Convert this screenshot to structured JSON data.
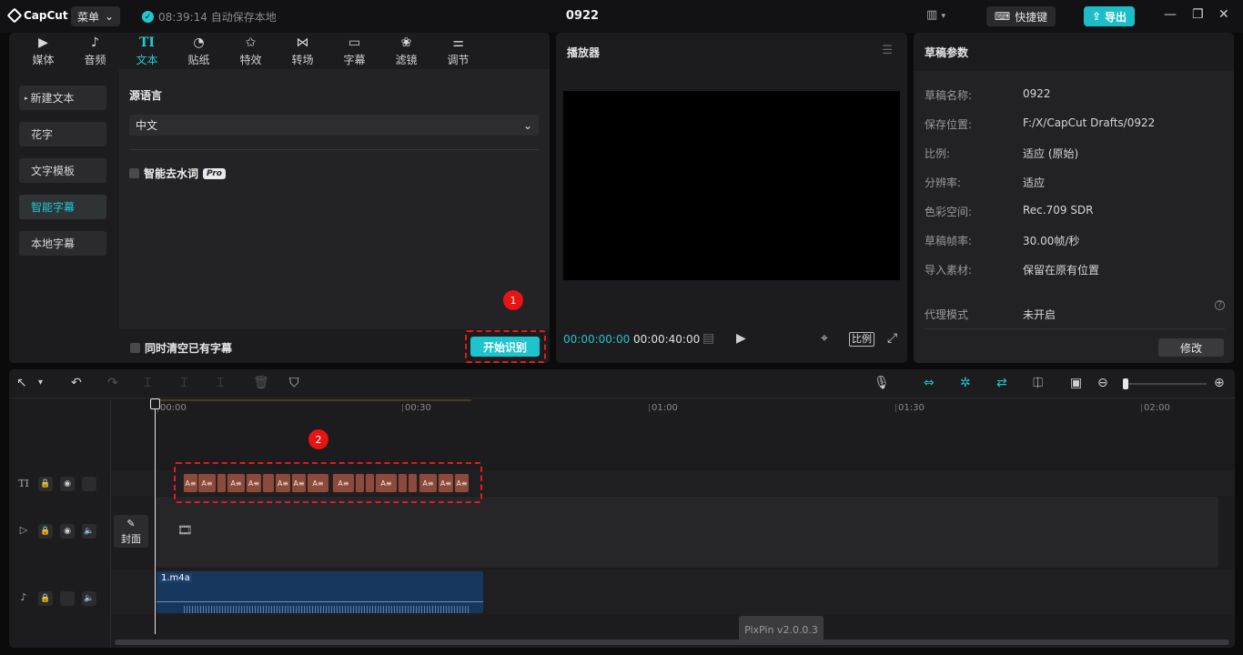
{
  "app": {
    "logo_text": "CapCut",
    "menu_label": "菜单",
    "autosave_text": "08:39:14 自动保存本地",
    "project_title": "0922",
    "shortcut_label": "快捷键",
    "export_label": "导出"
  },
  "tabs": [
    {
      "label": "媒体",
      "icon": "media-icon"
    },
    {
      "label": "音频",
      "icon": "audio-icon"
    },
    {
      "label": "文本",
      "icon": "text-icon",
      "glyph": "TI"
    },
    {
      "label": "贴纸",
      "icon": "sticker-icon"
    },
    {
      "label": "特效",
      "icon": "effects-icon"
    },
    {
      "label": "转场",
      "icon": "transition-icon"
    },
    {
      "label": "字幕",
      "icon": "captions-icon"
    },
    {
      "label": "滤镜",
      "icon": "filter-icon"
    },
    {
      "label": "调节",
      "icon": "adjust-icon"
    }
  ],
  "sidebar": {
    "items": [
      "新建文本",
      "花字",
      "文字模板",
      "智能字幕",
      "本地字幕"
    ],
    "active": "智能字幕"
  },
  "caption": {
    "source_lang_label": "源语言",
    "source_lang_value": "中文",
    "filler_label": "智能去水词",
    "pro_badge": "Pro",
    "clear_label": "同时清空已有字幕",
    "start_label": "开始识别",
    "marker1": "1",
    "marker2": "2"
  },
  "player": {
    "title": "播放器",
    "current_time": "00:00:00:00",
    "total_time": "00:00:40:00",
    "ratio_label": "比例"
  },
  "draft": {
    "title": "草稿参数",
    "params": [
      {
        "k": "草稿名称:",
        "v": "0922"
      },
      {
        "k": "保存位置:",
        "v": "F:/X/CapCut Drafts/0922"
      },
      {
        "k": "比例:",
        "v": "适应 (原始)"
      },
      {
        "k": "分辨率:",
        "v": "适应"
      },
      {
        "k": "色彩空间:",
        "v": "Rec.709 SDR"
      },
      {
        "k": "草稿帧率:",
        "v": "30.00帧/秒"
      },
      {
        "k": "导入素材:",
        "v": "保留在原有位置"
      }
    ],
    "proxy_k": "代理模式",
    "proxy_v": "未开启",
    "modify_label": "修改"
  },
  "timeline": {
    "ruler": [
      "00:00",
      "00:30",
      "01:00",
      "01:30",
      "02:00"
    ],
    "cover_label": "封面",
    "audio_clip_name": "1.m4a",
    "subtitle_chip_text": "A≡"
  },
  "watermark": "PixPin v2.0.0.3",
  "colors": {
    "accent": "#1ec3cd",
    "highlight": "#e21b1b",
    "subtitle_clip": "#8b4a3b",
    "audio_clip": "#16365e"
  }
}
